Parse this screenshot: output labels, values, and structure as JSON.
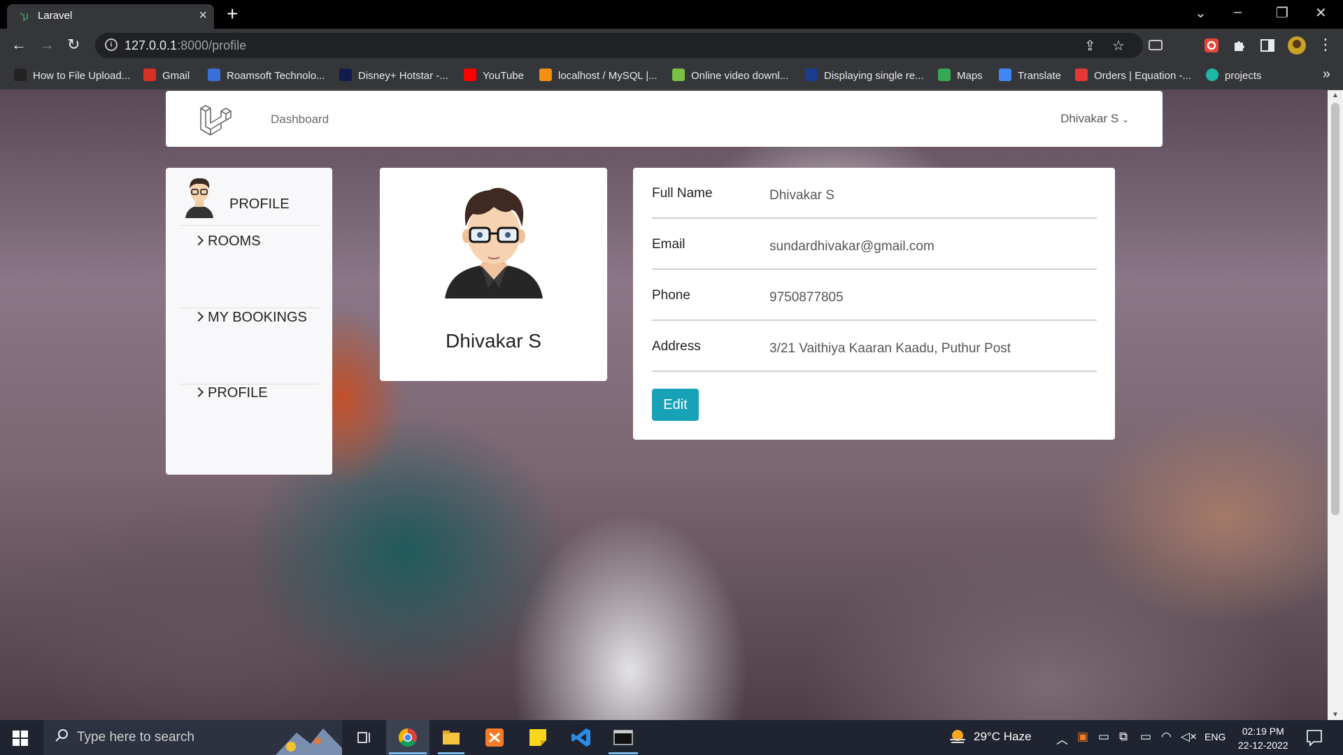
{
  "browser": {
    "tab_title": "Laravel",
    "url_host": "127.0.0.1",
    "url_rest": ":8000/profile",
    "bookmarks": [
      {
        "label": "How to File Upload...",
        "color": "#222"
      },
      {
        "label": "Gmail",
        "color": "#d93025"
      },
      {
        "label": "Roamsoft Technolo...",
        "color": "#3b6fd8"
      },
      {
        "label": "Disney+ Hotstar -...",
        "color": "#0f1c4d"
      },
      {
        "label": "YouTube",
        "color": "#ff0000"
      },
      {
        "label": "localhost / MySQL |...",
        "color": "#f29111"
      },
      {
        "label": "Online video downl...",
        "color": "#7ac143"
      },
      {
        "label": "Displaying single re...",
        "color": "#1b3c8f"
      },
      {
        "label": "Maps",
        "color": "#34a853"
      },
      {
        "label": "Translate",
        "color": "#4285f4"
      },
      {
        "label": "Orders | Equation -...",
        "color": "#e53935"
      },
      {
        "label": "projects",
        "color": "#1fb6a8"
      }
    ]
  },
  "nav": {
    "dashboard": "Dashboard",
    "user": "Dhivakar S"
  },
  "sidebar": {
    "heading": "PROFILE",
    "items": [
      {
        "label": "ROOMS"
      },
      {
        "label": "MY BOOKINGS"
      },
      {
        "label": "PROFILE"
      }
    ]
  },
  "profile": {
    "name": "Dhivakar S"
  },
  "details": {
    "rows": [
      {
        "label": "Full Name",
        "value": "Dhivakar S"
      },
      {
        "label": "Email",
        "value": "sundardhivakar@gmail.com"
      },
      {
        "label": "Phone",
        "value": "9750877805"
      },
      {
        "label": "Address",
        "value": "3/21 Vaithiya Kaaran Kaadu, Puthur Post"
      }
    ],
    "edit_label": "Edit"
  },
  "taskbar": {
    "search_placeholder": "Type here to search",
    "weather": "29°C  Haze",
    "lang": "ENG",
    "time": "02:19 PM",
    "date": "22-12-2022"
  },
  "colors": {
    "accent": "#17a2b8"
  }
}
